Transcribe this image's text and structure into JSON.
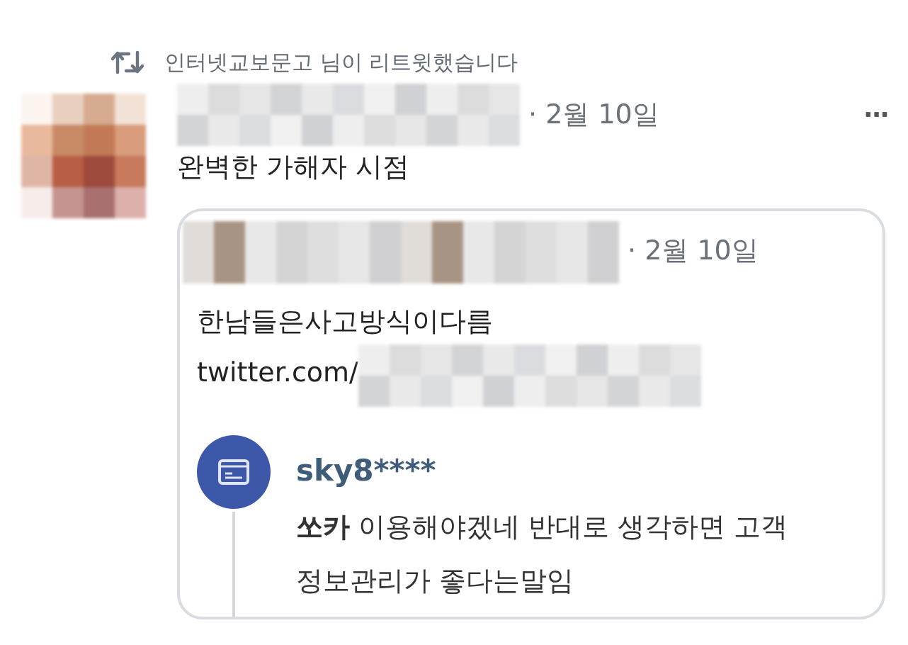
{
  "retweet_banner": {
    "text": "인터넷교보문고 님이 리트윗했습니다"
  },
  "tweet": {
    "date": "· 2월 10일",
    "more": "···",
    "text": "완벽한 가해자 시점",
    "quoted_tweet": {
      "date": "· 2월 10일",
      "text": "한남들은사고방식이다름",
      "link": "twitter.com/",
      "comment": {
        "username": "sky8****",
        "text": "**쏘카** 이용해야겠네 반대로 생각하면 고객 정보관리가 좋다는말임"
      }
    }
  }
}
